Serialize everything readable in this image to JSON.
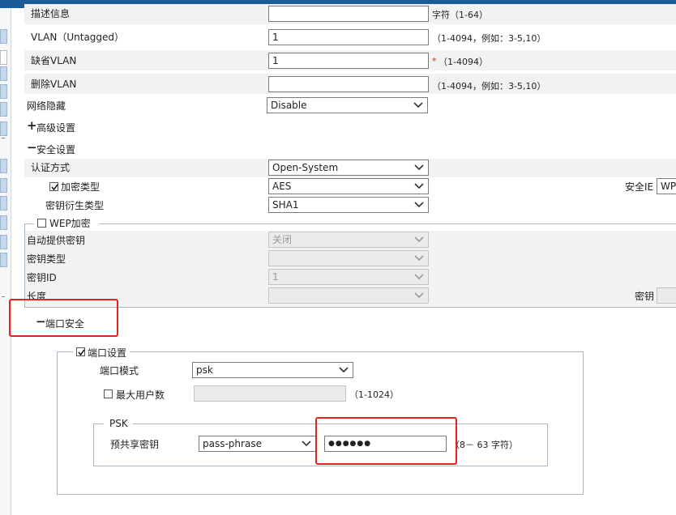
{
  "form": {
    "desc": {
      "label": "描述信息",
      "value": "",
      "hint": "字符（1-64）"
    },
    "vlan_untagged": {
      "label": "VLAN（Untagged）",
      "value": "1",
      "hint": "（1-4094，例如：3-5,10）"
    },
    "default_vlan": {
      "label": "缺省VLAN",
      "value": "1",
      "required_mark": "*",
      "hint": "（1-4094）"
    },
    "delete_vlan": {
      "label": "删除VLAN",
      "value": "",
      "hint": "（1-4094，例如：3-5,10）"
    },
    "hide_network": {
      "label": "网络隐藏",
      "value": "Disable"
    }
  },
  "advanced": {
    "expander": "+",
    "label": "高级设置"
  },
  "security": {
    "expander": "−",
    "label": "安全设置",
    "auth": {
      "label": "认证方式",
      "value": "Open-System"
    },
    "encryption": {
      "label": "加密类型",
      "checked": true,
      "value": "AES"
    },
    "key_derive": {
      "label": "密钥衍生类型",
      "value": "SHA1"
    },
    "security_ie": {
      "label": "安全IE",
      "value": "WP"
    }
  },
  "wep": {
    "label": "WEP加密",
    "checked": false,
    "auto_key": {
      "label": "自动提供密钥",
      "value": "关闭"
    },
    "key_type": {
      "label": "密钥类型",
      "value": ""
    },
    "key_id": {
      "label": "密钥ID",
      "value": "1"
    },
    "length": {
      "label": "长度",
      "value": ""
    },
    "key": {
      "label": "密钥",
      "value": ""
    }
  },
  "port_security": {
    "expander": "−",
    "label": "端口安全",
    "port_settings": {
      "label": "端口设置",
      "checked": true
    },
    "port_mode": {
      "label": "端口模式",
      "value": "psk"
    },
    "max_users": {
      "label": "最大用户数",
      "checked": false,
      "value": "",
      "hint": "（1-1024）"
    },
    "psk": {
      "legend": "PSK",
      "label": "预共享密钥",
      "type_value": "pass-phrase",
      "key_value": "●●●●●●",
      "hint": "（8－ 63 字符）"
    }
  },
  "colors": {
    "accent": "#1c5b9a",
    "highlight": "#e8231e",
    "row_gray": "#f2f2f2"
  }
}
